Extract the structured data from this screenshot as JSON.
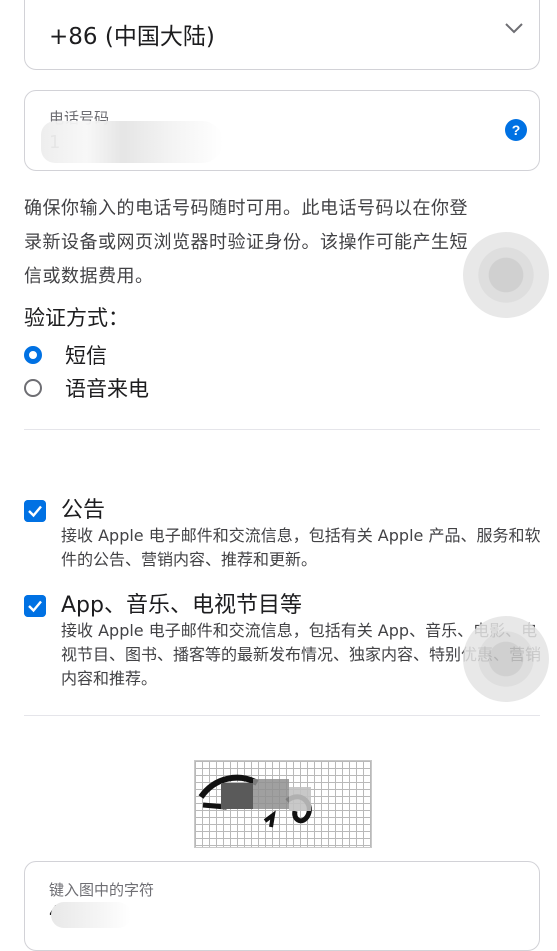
{
  "country": {
    "value": "+86 (中国大陆)",
    "icon": "chevron-down-icon"
  },
  "phone": {
    "label": "电话号码",
    "value": "1",
    "help_symbol": "?"
  },
  "notice": "确保你输入的电话号码随时可用。此电话号码以在你登录新设备或网页浏览器时验证身份。该操作可能产生短信或数据费用。",
  "verification": {
    "title": "验证方式：",
    "options": [
      {
        "label": "短信",
        "selected": true
      },
      {
        "label": "语音来电",
        "selected": false
      }
    ]
  },
  "subscriptions": [
    {
      "title": "公告",
      "checked": true,
      "description": "接收 Apple 电子邮件和交流信息，包括有关 Apple 产品、服务和软件的公告、营销内容、推荐和更新。"
    },
    {
      "title": "App、音乐、电视节目等",
      "checked": true,
      "description": "接收 Apple 电子邮件和交流信息，包括有关 App、音乐、电影、电视节目、图书、播客等的最新发布情况、独家内容、特别优惠、营销内容和推荐。"
    }
  ],
  "captcha": {
    "label": "键入图中的字符",
    "value": "4"
  },
  "colors": {
    "accent": "#0071e3",
    "border": "#d2d2d7"
  }
}
